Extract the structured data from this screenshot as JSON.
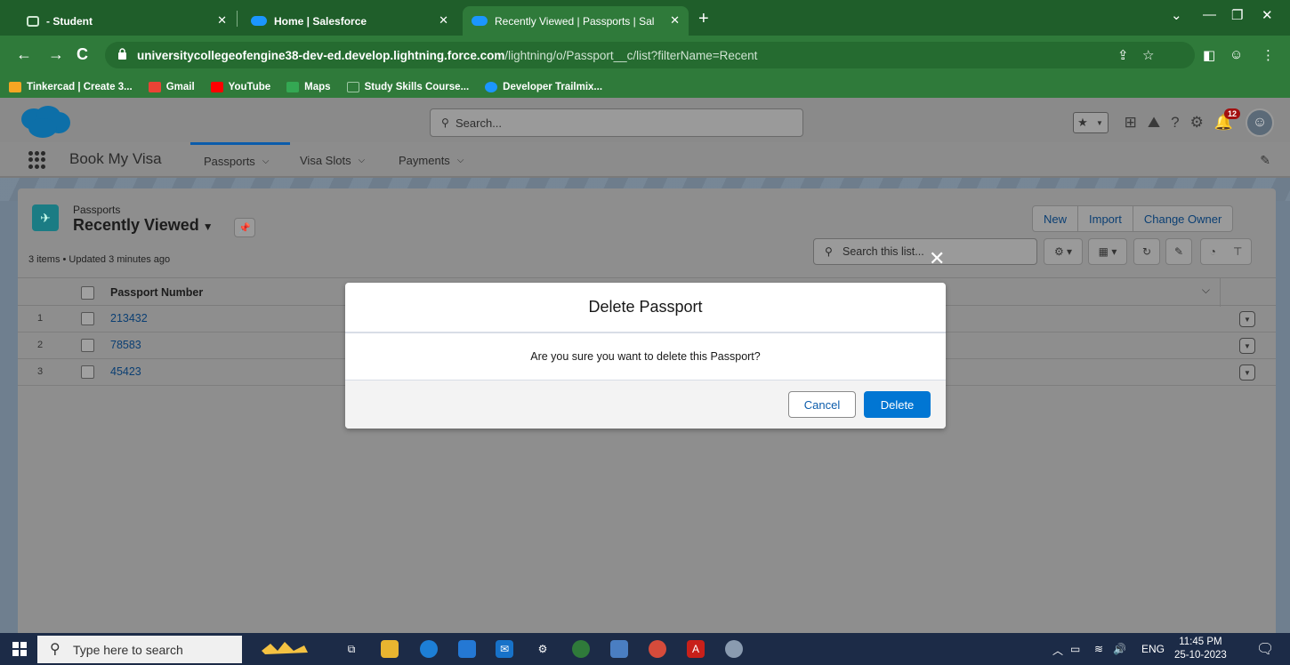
{
  "browser": {
    "tabs": [
      {
        "title": "- Student",
        "active": false
      },
      {
        "title": "Home | Salesforce",
        "active": false
      },
      {
        "title": "Recently Viewed | Passports | Sal",
        "active": true
      }
    ],
    "url_host": "universitycollegeofengine38-dev-ed.develop.lightning.force.com",
    "url_path": "/lightning/o/Passport__c/list?filterName=Recent",
    "bookmarks": [
      {
        "label": "Tinkercad | Create 3...",
        "icon_color": "#f5a623"
      },
      {
        "label": "Gmail",
        "icon_color": "#ea4335"
      },
      {
        "label": "YouTube",
        "icon_color": "#ff0000"
      },
      {
        "label": "Maps",
        "icon_color": "#34a853"
      },
      {
        "label": "Study Skills Course...",
        "icon_color": "#2f7a3a"
      },
      {
        "label": "Developer Trailmix...",
        "icon_color": "#1b96ff"
      }
    ]
  },
  "sf": {
    "search_placeholder": "Search...",
    "notification_count": "12",
    "app_name": "Book My Visa",
    "nav": [
      {
        "label": "Passports",
        "active": true
      },
      {
        "label": "Visa Slots",
        "active": false
      },
      {
        "label": "Payments",
        "active": false
      }
    ]
  },
  "list": {
    "object_label": "Passports",
    "view_name": "Recently Viewed",
    "meta": "3 items • Updated 3 minutes ago",
    "buttons": {
      "new": "New",
      "import": "Import",
      "change_owner": "Change Owner"
    },
    "search_placeholder": "Search this list...",
    "column": "Passport Number",
    "rows": [
      {
        "num": "1",
        "value": "213432"
      },
      {
        "num": "2",
        "value": "78583"
      },
      {
        "num": "3",
        "value": "45423"
      }
    ]
  },
  "modal": {
    "title": "Delete Passport",
    "message": "Are you sure you want to delete this Passport?",
    "cancel": "Cancel",
    "delete": "Delete"
  },
  "taskbar": {
    "search_placeholder": "Type here to search",
    "language": "ENG",
    "time": "11:45 PM",
    "date": "25-10-2023"
  },
  "colors": {
    "browser_frame": "#2f7a3a",
    "sf_brand_blue": "#0176d3",
    "overlay_gray": "#8e8e8e"
  }
}
